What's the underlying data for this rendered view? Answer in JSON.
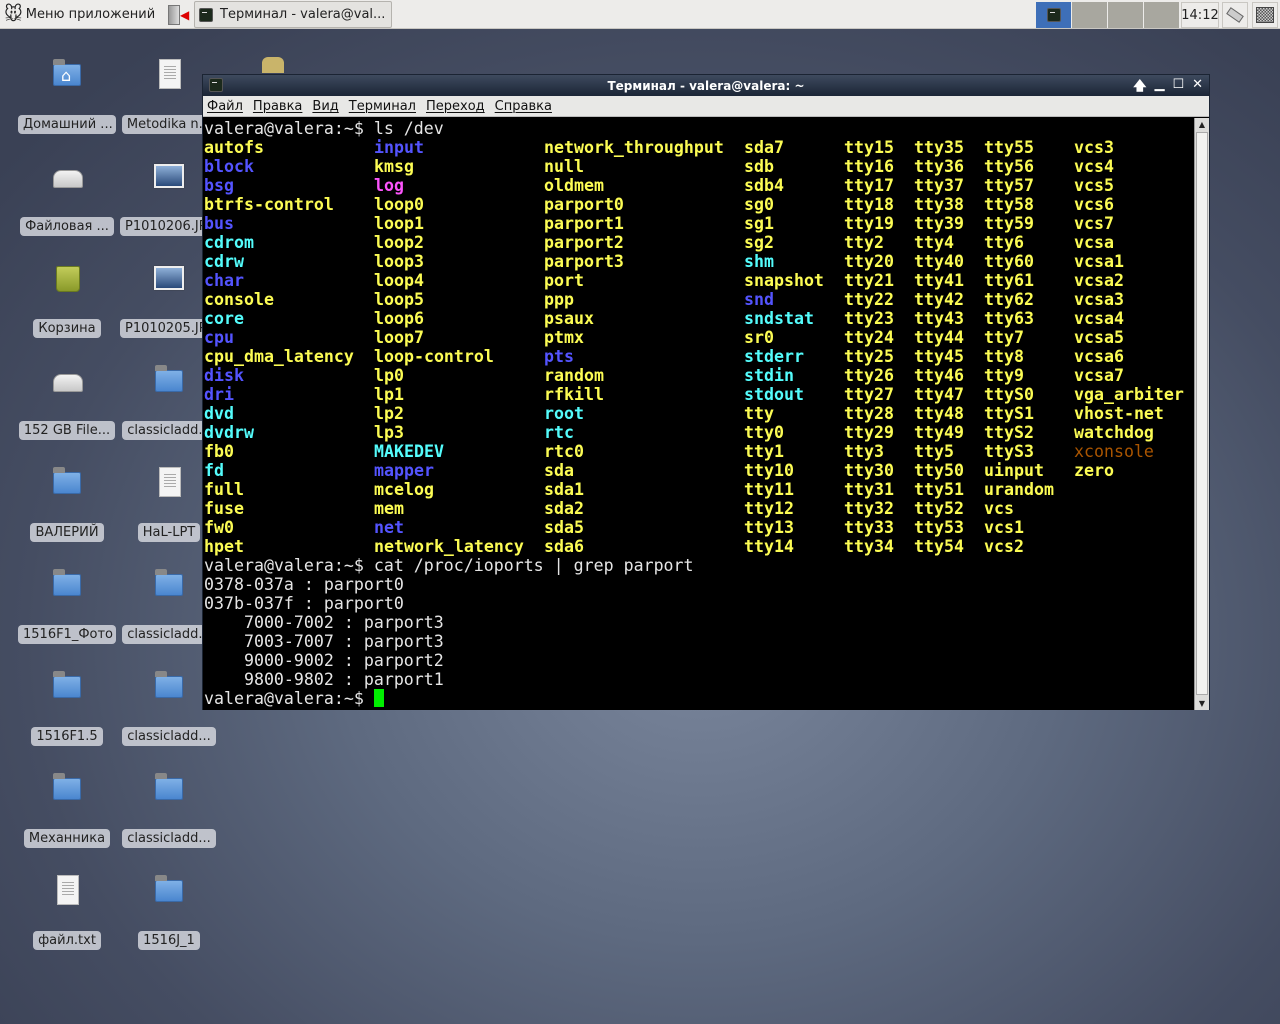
{
  "panel": {
    "menu_label": "Меню приложений",
    "task_label": "Терминал - valera@val...",
    "clock": "14:12",
    "workspaces": 4,
    "active_workspace": 1
  },
  "desktop": {
    "icons": [
      {
        "label": "Домашний ...",
        "type": "home"
      },
      {
        "label": "Metodika n...",
        "type": "doc"
      },
      {
        "label": "Файловая ...",
        "type": "drive"
      },
      {
        "label": "P1010206.JPG",
        "type": "pic"
      },
      {
        "label": "Корзина",
        "type": "trash"
      },
      {
        "label": "P1010205.JPG",
        "type": "pic"
      },
      {
        "label": "152 GB File...",
        "type": "drive"
      },
      {
        "label": "classicladd...",
        "type": "folder"
      },
      {
        "label": "ВАЛЕРИЙ",
        "type": "folder"
      },
      {
        "label": "HaL-LPT",
        "type": "doc"
      },
      {
        "label": "1516F1_Фото",
        "type": "folder"
      },
      {
        "label": "classicladd...",
        "type": "folder"
      },
      {
        "label": "1516F1.5",
        "type": "folder"
      },
      {
        "label": "classicladd...",
        "type": "folder"
      },
      {
        "label": "Механника",
        "type": "folder"
      },
      {
        "label": "classicladd...",
        "type": "folder"
      },
      {
        "label": "файл.txt",
        "type": "doc"
      },
      {
        "label": "1516J_1",
        "type": "folder"
      }
    ]
  },
  "window": {
    "title": "Терминал - valera@valera: ~",
    "menu": [
      "Файл",
      "Правка",
      "Вид",
      "Терминал",
      "Переход",
      "Справка"
    ]
  },
  "colors": {
    "y": "#fcfc54",
    "b": "#5454ff",
    "c": "#54fcfc",
    "m": "#fc54fc",
    "o": "#aa5500",
    "text": "#e5e5e5",
    "cursor": "#00ee00"
  },
  "terminal": {
    "cmd1": "valera@valera:~$ ls /dev",
    "listing": [
      [
        [
          "autofs",
          "y"
        ],
        [
          "block",
          "b"
        ],
        [
          "bsg",
          "b"
        ],
        [
          "btrfs-control",
          "y"
        ],
        [
          "bus",
          "b"
        ],
        [
          "cdrom",
          "c"
        ],
        [
          "cdrw",
          "c"
        ],
        [
          "char",
          "b"
        ],
        [
          "console",
          "y"
        ],
        [
          "core",
          "c"
        ],
        [
          "cpu",
          "b"
        ],
        [
          "cpu_dma_latency",
          "y"
        ],
        [
          "disk",
          "b"
        ],
        [
          "dri",
          "b"
        ],
        [
          "dvd",
          "c"
        ],
        [
          "dvdrw",
          "c"
        ],
        [
          "fb0",
          "y"
        ],
        [
          "fd",
          "c"
        ],
        [
          "full",
          "y"
        ],
        [
          "fuse",
          "y"
        ],
        [
          "fw0",
          "y"
        ],
        [
          "hpet",
          "y"
        ]
      ],
      [
        [
          "input",
          "b"
        ],
        [
          "kmsg",
          "y"
        ],
        [
          "log",
          "m"
        ],
        [
          "loop0",
          "y"
        ],
        [
          "loop1",
          "y"
        ],
        [
          "loop2",
          "y"
        ],
        [
          "loop3",
          "y"
        ],
        [
          "loop4",
          "y"
        ],
        [
          "loop5",
          "y"
        ],
        [
          "loop6",
          "y"
        ],
        [
          "loop7",
          "y"
        ],
        [
          "loop-control",
          "y"
        ],
        [
          "lp0",
          "y"
        ],
        [
          "lp1",
          "y"
        ],
        [
          "lp2",
          "y"
        ],
        [
          "lp3",
          "y"
        ],
        [
          "MAKEDEV",
          "c"
        ],
        [
          "mapper",
          "b"
        ],
        [
          "mcelog",
          "y"
        ],
        [
          "mem",
          "y"
        ],
        [
          "net",
          "b"
        ],
        [
          "network_latency",
          "y"
        ]
      ],
      [
        [
          "network_throughput",
          "y"
        ],
        [
          "null",
          "y"
        ],
        [
          "oldmem",
          "y"
        ],
        [
          "parport0",
          "y"
        ],
        [
          "parport1",
          "y"
        ],
        [
          "parport2",
          "y"
        ],
        [
          "parport3",
          "y"
        ],
        [
          "port",
          "y"
        ],
        [
          "ppp",
          "y"
        ],
        [
          "psaux",
          "y"
        ],
        [
          "ptmx",
          "y"
        ],
        [
          "pts",
          "b"
        ],
        [
          "random",
          "y"
        ],
        [
          "rfkill",
          "y"
        ],
        [
          "root",
          "c"
        ],
        [
          "rtc",
          "c"
        ],
        [
          "rtc0",
          "y"
        ],
        [
          "sda",
          "y"
        ],
        [
          "sda1",
          "y"
        ],
        [
          "sda2",
          "y"
        ],
        [
          "sda5",
          "y"
        ],
        [
          "sda6",
          "y"
        ]
      ],
      [
        [
          "sda7",
          "y"
        ],
        [
          "sdb",
          "y"
        ],
        [
          "sdb4",
          "y"
        ],
        [
          "sg0",
          "y"
        ],
        [
          "sg1",
          "y"
        ],
        [
          "sg2",
          "y"
        ],
        [
          "shm",
          "c"
        ],
        [
          "snapshot",
          "y"
        ],
        [
          "snd",
          "b"
        ],
        [
          "sndstat",
          "c"
        ],
        [
          "sr0",
          "y"
        ],
        [
          "stderr",
          "c"
        ],
        [
          "stdin",
          "c"
        ],
        [
          "stdout",
          "c"
        ],
        [
          "tty",
          "y"
        ],
        [
          "tty0",
          "y"
        ],
        [
          "tty1",
          "y"
        ],
        [
          "tty10",
          "y"
        ],
        [
          "tty11",
          "y"
        ],
        [
          "tty12",
          "y"
        ],
        [
          "tty13",
          "y"
        ],
        [
          "tty14",
          "y"
        ]
      ],
      [
        [
          "tty15",
          "y"
        ],
        [
          "tty16",
          "y"
        ],
        [
          "tty17",
          "y"
        ],
        [
          "tty18",
          "y"
        ],
        [
          "tty19",
          "y"
        ],
        [
          "tty2",
          "y"
        ],
        [
          "tty20",
          "y"
        ],
        [
          "tty21",
          "y"
        ],
        [
          "tty22",
          "y"
        ],
        [
          "tty23",
          "y"
        ],
        [
          "tty24",
          "y"
        ],
        [
          "tty25",
          "y"
        ],
        [
          "tty26",
          "y"
        ],
        [
          "tty27",
          "y"
        ],
        [
          "tty28",
          "y"
        ],
        [
          "tty29",
          "y"
        ],
        [
          "tty3",
          "y"
        ],
        [
          "tty30",
          "y"
        ],
        [
          "tty31",
          "y"
        ],
        [
          "tty32",
          "y"
        ],
        [
          "tty33",
          "y"
        ],
        [
          "tty34",
          "y"
        ]
      ],
      [
        [
          "tty35",
          "y"
        ],
        [
          "tty36",
          "y"
        ],
        [
          "tty37",
          "y"
        ],
        [
          "tty38",
          "y"
        ],
        [
          "tty39",
          "y"
        ],
        [
          "tty4",
          "y"
        ],
        [
          "tty40",
          "y"
        ],
        [
          "tty41",
          "y"
        ],
        [
          "tty42",
          "y"
        ],
        [
          "tty43",
          "y"
        ],
        [
          "tty44",
          "y"
        ],
        [
          "tty45",
          "y"
        ],
        [
          "tty46",
          "y"
        ],
        [
          "tty47",
          "y"
        ],
        [
          "tty48",
          "y"
        ],
        [
          "tty49",
          "y"
        ],
        [
          "tty5",
          "y"
        ],
        [
          "tty50",
          "y"
        ],
        [
          "tty51",
          "y"
        ],
        [
          "tty52",
          "y"
        ],
        [
          "tty53",
          "y"
        ],
        [
          "tty54",
          "y"
        ]
      ],
      [
        [
          "tty55",
          "y"
        ],
        [
          "tty56",
          "y"
        ],
        [
          "tty57",
          "y"
        ],
        [
          "tty58",
          "y"
        ],
        [
          "tty59",
          "y"
        ],
        [
          "tty6",
          "y"
        ],
        [
          "tty60",
          "y"
        ],
        [
          "tty61",
          "y"
        ],
        [
          "tty62",
          "y"
        ],
        [
          "tty63",
          "y"
        ],
        [
          "tty7",
          "y"
        ],
        [
          "tty8",
          "y"
        ],
        [
          "tty9",
          "y"
        ],
        [
          "ttyS0",
          "y"
        ],
        [
          "ttyS1",
          "y"
        ],
        [
          "ttyS2",
          "y"
        ],
        [
          "ttyS3",
          "y"
        ],
        [
          "uinput",
          "y"
        ],
        [
          "urandom",
          "y"
        ],
        [
          "vcs",
          "y"
        ],
        [
          "vcs1",
          "y"
        ],
        [
          "vcs2",
          "y"
        ]
      ],
      [
        [
          "vcs3",
          "y"
        ],
        [
          "vcs4",
          "y"
        ],
        [
          "vcs5",
          "y"
        ],
        [
          "vcs6",
          "y"
        ],
        [
          "vcs7",
          "y"
        ],
        [
          "vcsa",
          "y"
        ],
        [
          "vcsa1",
          "y"
        ],
        [
          "vcsa2",
          "y"
        ],
        [
          "vcsa3",
          "y"
        ],
        [
          "vcsa4",
          "y"
        ],
        [
          "vcsa5",
          "y"
        ],
        [
          "vcsa6",
          "y"
        ],
        [
          "vcsa7",
          "y"
        ],
        [
          "vga_arbiter",
          "y"
        ],
        [
          "vhost-net",
          "y"
        ],
        [
          "watchdog",
          "y"
        ],
        [
          "xconsole",
          "o"
        ],
        [
          "zero",
          "y"
        ]
      ]
    ],
    "cmd2": "valera@valera:~$ cat /proc/ioports | grep parport",
    "output": [
      "0378-037a : parport0",
      "037b-037f : parport0",
      "    7000-7002 : parport3",
      "    7003-7007 : parport3",
      "    9000-9002 : parport2",
      "    9800-9802 : parport1"
    ],
    "prompt": "valera@valera:~$ "
  }
}
